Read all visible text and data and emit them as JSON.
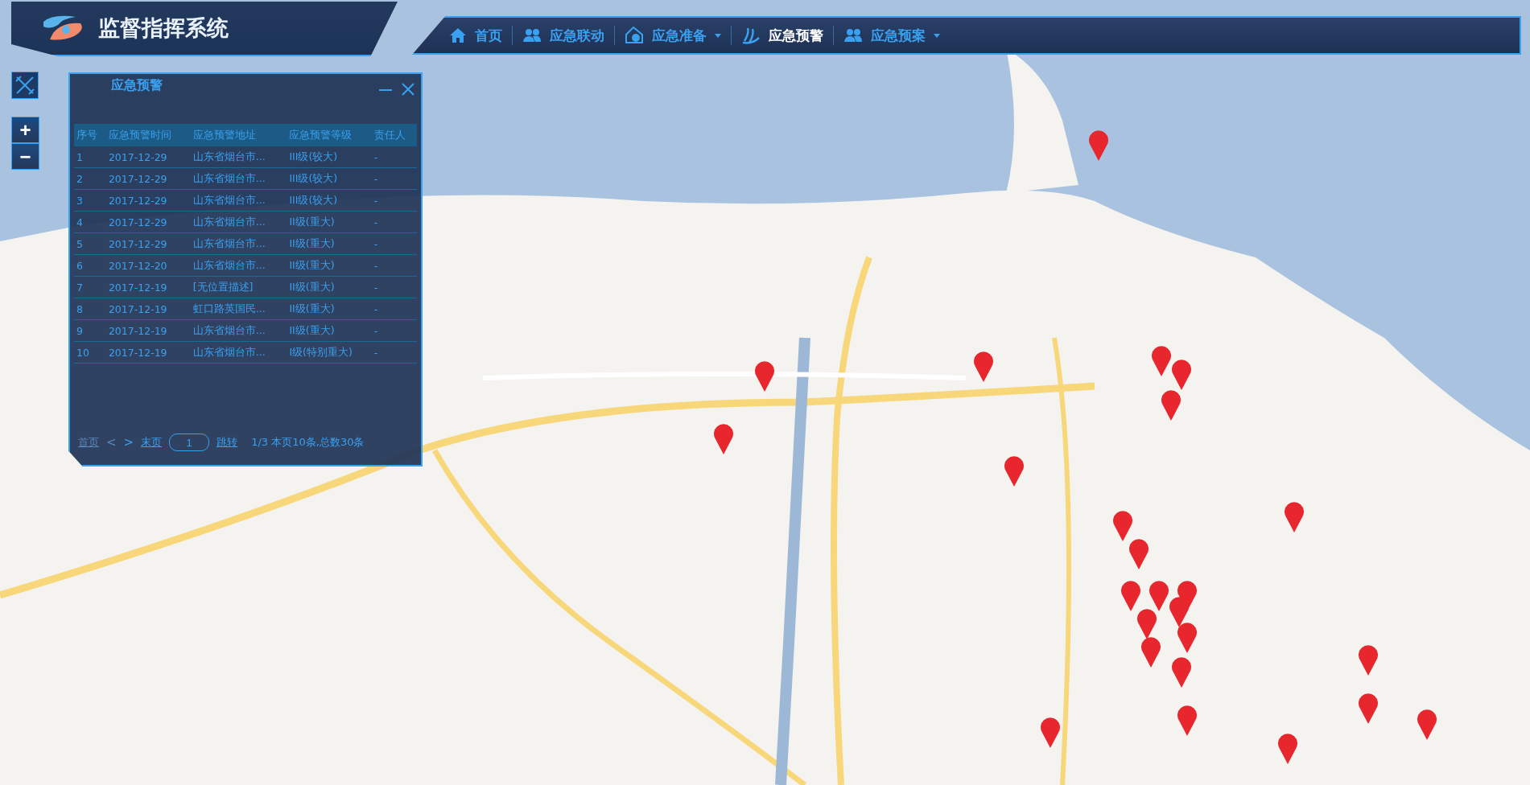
{
  "app": {
    "title": "监督指挥系统"
  },
  "nav": [
    {
      "label": "首页",
      "kind": "home",
      "dropdown": false,
      "selected": false
    },
    {
      "label": "应急联动",
      "kind": "people",
      "dropdown": false,
      "selected": false
    },
    {
      "label": "应急准备",
      "kind": "house",
      "dropdown": true,
      "selected": false
    },
    {
      "label": "应急预警",
      "kind": "wave",
      "dropdown": false,
      "selected": true
    },
    {
      "label": "应急预案",
      "kind": "people",
      "dropdown": true,
      "selected": false
    }
  ],
  "panel": {
    "title": "应急预警",
    "columns": [
      "序号",
      "应急预警时间",
      "应急预警地址",
      "应急预警等级",
      "责任人"
    ],
    "rows": [
      [
        "1",
        "2017-12-29",
        "山东省烟台市...",
        "III级(较大)",
        "-"
      ],
      [
        "2",
        "2017-12-29",
        "山东省烟台市...",
        "III级(较大)",
        "-"
      ],
      [
        "3",
        "2017-12-29",
        "山东省烟台市...",
        "III级(较大)",
        "-"
      ],
      [
        "4",
        "2017-12-29",
        "山东省烟台市...",
        "II级(重大)",
        "-"
      ],
      [
        "5",
        "2017-12-29",
        "山东省烟台市...",
        "II级(重大)",
        "-"
      ],
      [
        "6",
        "2017-12-20",
        "山东省烟台市...",
        "II级(重大)",
        "-"
      ],
      [
        "7",
        "2017-12-19",
        "[无位置描述]",
        "II级(重大)",
        "-"
      ],
      [
        "8",
        "2017-12-19",
        "虹口路英国民...",
        "II级(重大)",
        "-"
      ],
      [
        "9",
        "2017-12-19",
        "山东省烟台市...",
        "II级(重大)",
        "-"
      ],
      [
        "10",
        "2017-12-19",
        "山东省烟台市...",
        "I级(特别重大)",
        "-"
      ]
    ],
    "pager": {
      "first": {
        "label": "首页",
        "disabled": true
      },
      "prev": {
        "label": "<",
        "disabled": true
      },
      "next": {
        "label": ">",
        "disabled": false
      },
      "last": {
        "label": "末页",
        "disabled": false
      },
      "page": "1",
      "go": "跳转",
      "info": "1/3 本页10条,总数30条"
    }
  },
  "map_controls": {
    "zoom_in": "+",
    "zoom_out": "−"
  }
}
